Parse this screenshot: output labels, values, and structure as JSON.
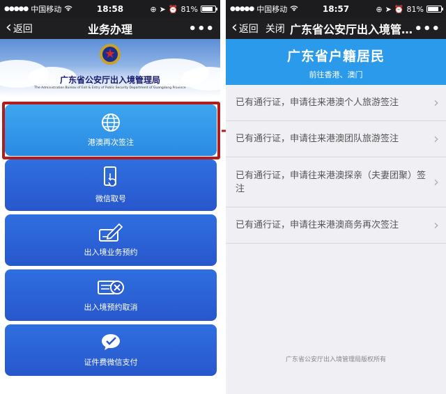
{
  "left_screen": {
    "status_bar": {
      "carrier": "中国移动",
      "time": "18:58",
      "battery": "81%"
    },
    "nav": {
      "back_label": "返回",
      "title": "业务办理",
      "more": "•••"
    },
    "banner": {
      "org_name_cn": "广东省公安厅出入境管理局",
      "org_name_en": "The Administration Bureau of Exit & Entry of Public Security Department of Guangdong Province"
    },
    "tiles": [
      {
        "label": "港澳再次签注",
        "icon": "globe-icon"
      },
      {
        "label": "微信取号",
        "icon": "phone-touch-icon"
      },
      {
        "label": "出入境业务预约",
        "icon": "signing-icon"
      },
      {
        "label": "出入境预约取消",
        "icon": "cancel-card-icon"
      },
      {
        "label": "证件费微信支付",
        "icon": "wechat-pay-icon"
      }
    ]
  },
  "right_screen": {
    "status_bar": {
      "carrier": "中国移动",
      "time": "18:57",
      "battery": "81%"
    },
    "nav": {
      "back_label": "返回",
      "close_label": "关闭",
      "title": "广东省公安厅出入境管理局",
      "more": "•••"
    },
    "header": {
      "title": "广东省户籍居民",
      "subtitle": "前往香港、澳门"
    },
    "items": [
      {
        "label": "已有通行证，申请往来港澳个人旅游签注"
      },
      {
        "label": "已有通行证，申请往来港澳团队旅游签注"
      },
      {
        "label": "已有通行证，申请往来港澳探亲（夫妻团聚）签注"
      },
      {
        "label": "已有通行证，申请往来港澳商务再次签注"
      }
    ],
    "footer": "广东省公安厅出入境管理局版权所有"
  },
  "colors": {
    "tile_blue": "#2857cc",
    "tile_highlight": "#2a8ae3",
    "header_blue": "#2c9aea",
    "annotation_red": "#b11d1d"
  }
}
